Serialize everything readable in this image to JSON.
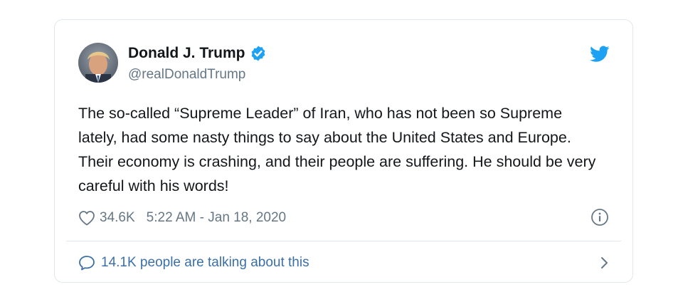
{
  "tweet": {
    "display_name": "Donald J. Trump",
    "handle": "@realDonaldTrump",
    "verified": true,
    "text": "The so-called “Supreme Leader” of Iran, who has not been so Supreme lately, had some nasty things to say about the United States and Europe. Their economy is crashing, and their people are suffering. He should be very careful with his words!",
    "likes": "34.6K",
    "timestamp": "5:22 AM - Jan 18, 2020",
    "talking": "14.1K people are talking about this"
  },
  "icons": {
    "verified": "verified-badge-icon",
    "brand": "twitter-bird-icon",
    "like": "heart-icon",
    "info": "info-icon",
    "reply": "speech-bubble-icon",
    "next": "chevron-right-icon"
  },
  "colors": {
    "twitter_blue": "#1da1f2",
    "link_blue": "#3b6fa6",
    "text_primary": "#14171a",
    "text_secondary": "#657786",
    "border": "#e1e8ed"
  }
}
